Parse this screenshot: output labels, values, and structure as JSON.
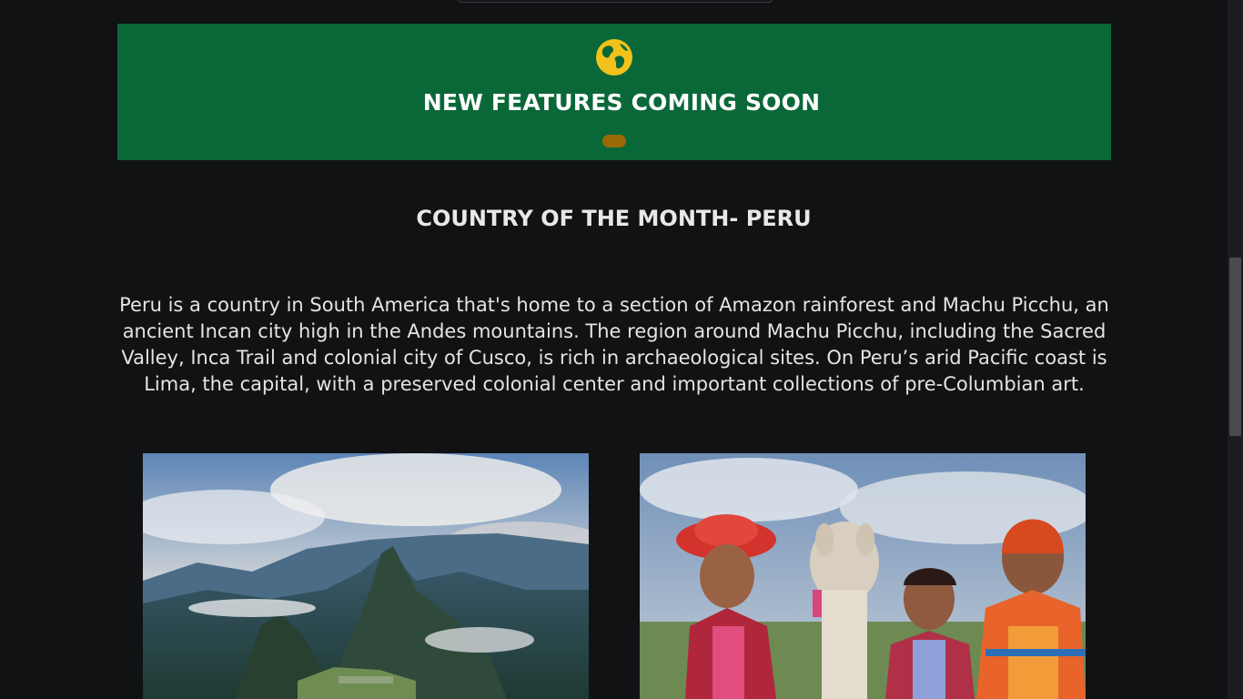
{
  "banner": {
    "title": "NEW FEATURES COMING SOON",
    "icon": "globe-icon",
    "background": "#0a6838",
    "accent": "#f2c21b"
  },
  "country": {
    "heading": "COUNTRY OF THE MONTH- PERU",
    "description": "Peru is a country in South America that's home to a section of Amazon rainforest and Machu Picchu, an ancient Incan city high in the Andes mountains. The region around Machu Picchu, including the Sacred Valley, Inca Trail and colonial city of Cusco, is rich in archaeological sites. On Peru’s arid Pacific coast is Lima, the capital, with a preserved colonial center and important collections of pre-Columbian art."
  },
  "photos": [
    "machu-picchu-photo",
    "peruvian-children-with-llama-photo"
  ]
}
